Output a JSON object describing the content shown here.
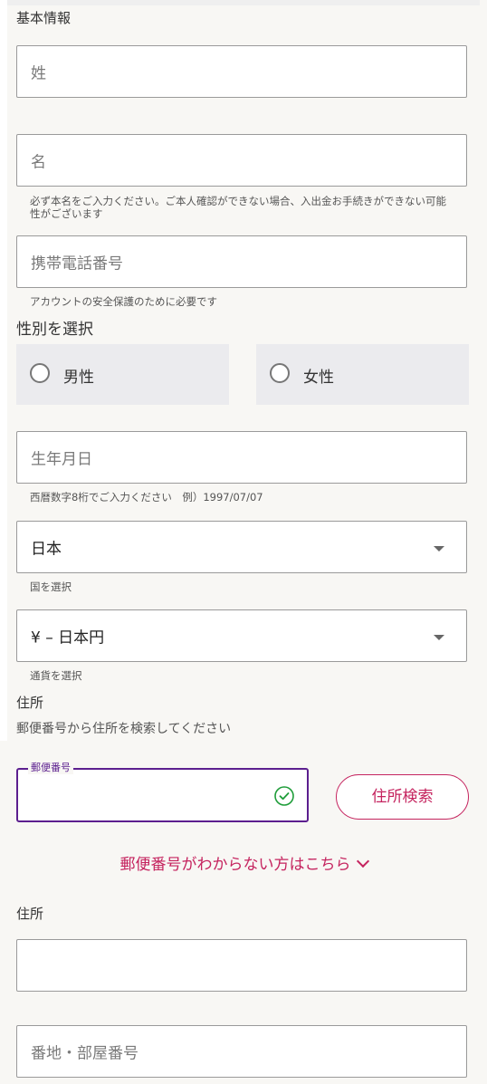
{
  "basic_info": {
    "title": "基本情報",
    "last_name_placeholder": "姓",
    "first_name_placeholder": "名",
    "name_note": "必ず本名をご入力ください。ご本人確認ができない場合、入出金お手続きができない可能性がございます",
    "phone_placeholder": "携帯電話番号",
    "phone_note": "アカウントの安全保護のために必要です"
  },
  "gender": {
    "title": "性別を選択",
    "options": [
      {
        "label": "男性",
        "selected": false
      },
      {
        "label": "女性",
        "selected": false
      }
    ]
  },
  "birthdate": {
    "placeholder": "生年月日",
    "note": "西暦数字8桁でご入力ください　例）1997/07/07"
  },
  "country": {
    "value": "日本",
    "note": "国を選択"
  },
  "currency": {
    "value": "¥ – 日本円",
    "note": "通貨を選択"
  },
  "address": {
    "title": "住所",
    "search_hint": "郵便番号から住所を検索してください",
    "postal_label": "郵便番号",
    "postal_value": "",
    "search_button": "住所検索",
    "unknown_postal_link": "郵便番号がわからない方はこちら",
    "address_label": "住所",
    "address_value": "",
    "street_placeholder": "番地・部屋番号"
  },
  "colors": {
    "accent": "#c5245f",
    "focus": "#5c1f8f",
    "valid": "#1f9d3a"
  }
}
